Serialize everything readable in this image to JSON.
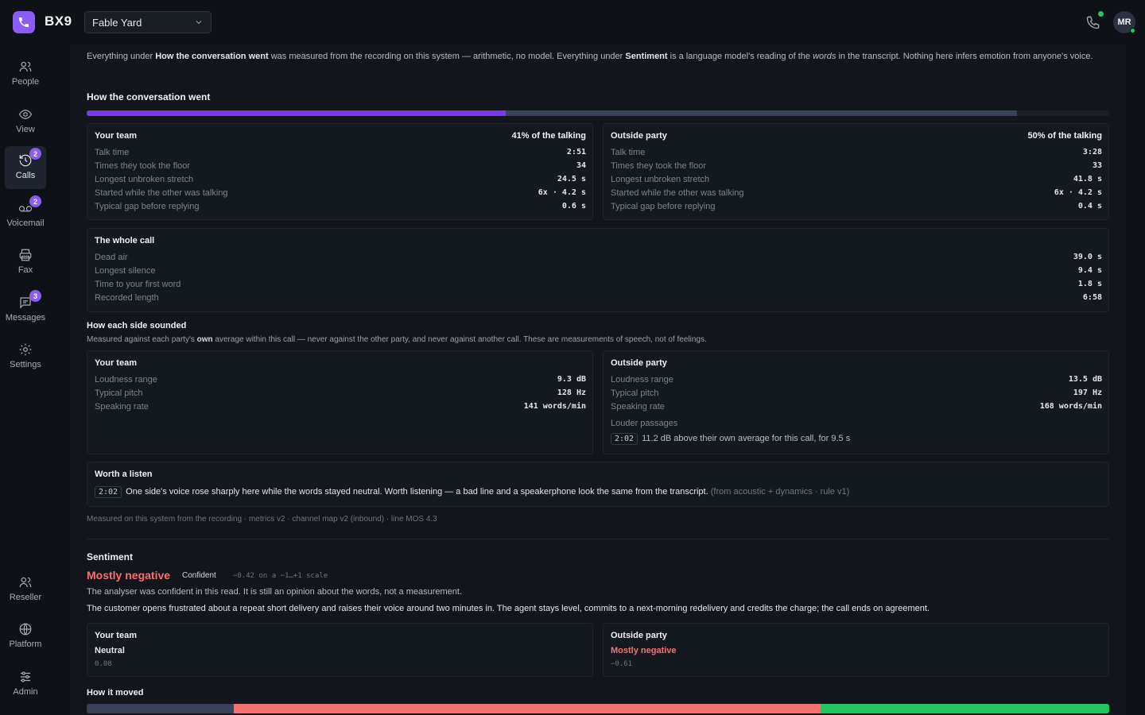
{
  "app": {
    "brand": "BX9",
    "org": "Fable Yard",
    "user_initials": "MR"
  },
  "colors": {
    "accent": "#8b5cf6",
    "negative": "#f87171",
    "positive": "#22c55e",
    "neutral_bar": "#394256"
  },
  "sidebar": {
    "items": [
      {
        "label": "People",
        "icon": "people-icon",
        "badge": ""
      },
      {
        "label": "View",
        "icon": "eye-icon",
        "badge": ""
      },
      {
        "label": "Calls",
        "icon": "history-icon",
        "badge": "2"
      },
      {
        "label": "Voicemail",
        "icon": "voicemail-icon",
        "badge": "2"
      },
      {
        "label": "Fax",
        "icon": "printer-icon",
        "badge": ""
      },
      {
        "label": "Messages",
        "icon": "message-icon",
        "badge": "3"
      },
      {
        "label": "Settings",
        "icon": "gear-icon",
        "badge": ""
      }
    ],
    "bottom": [
      {
        "label": "Reseller",
        "icon": "reseller-icon"
      },
      {
        "label": "Platform",
        "icon": "globe-icon"
      },
      {
        "label": "Admin",
        "icon": "sliders-icon"
      }
    ]
  },
  "intro": {
    "p1": "Everything under ",
    "b1": "How the conversation went",
    "p2": " was measured from the recording on this system — arithmetic, no model. Everything under ",
    "b2": "Sentiment",
    "p3": " is a language model's reading of the ",
    "i1": "words",
    "p4": " in the transcript. Nothing here infers emotion from anyone's voice."
  },
  "conversation": {
    "title": "How the conversation went",
    "talk_share": {
      "your_team": 0.41,
      "outside_party": 0.5
    },
    "your_team": {
      "title": "Your team",
      "share_label": "41% of the talking",
      "rows": [
        {
          "label": "Talk time",
          "value": "2:51"
        },
        {
          "label": "Times they took the floor",
          "value": "34"
        },
        {
          "label": "Longest unbroken stretch",
          "value": "24.5 s"
        },
        {
          "label": "Started while the other was talking",
          "value": "6x · 4.2 s"
        },
        {
          "label": "Typical gap before replying",
          "value": "0.6 s"
        }
      ]
    },
    "outside_party": {
      "title": "Outside party",
      "share_label": "50% of the talking",
      "rows": [
        {
          "label": "Talk time",
          "value": "3:28"
        },
        {
          "label": "Times they took the floor",
          "value": "33"
        },
        {
          "label": "Longest unbroken stretch",
          "value": "41.8 s"
        },
        {
          "label": "Started while the other was talking",
          "value": "6x · 4.2 s"
        },
        {
          "label": "Typical gap before replying",
          "value": "0.4 s"
        }
      ]
    },
    "whole_call": {
      "title": "The whole call",
      "rows": [
        {
          "label": "Dead air",
          "value": "39.0 s"
        },
        {
          "label": "Longest silence",
          "value": "9.4 s"
        },
        {
          "label": "Time to your first word",
          "value": "1.8 s"
        },
        {
          "label": "Recorded length",
          "value": "6:58"
        }
      ]
    }
  },
  "sounded": {
    "title": "How each side sounded",
    "sub_a": "Measured against each party's ",
    "sub_b": "own",
    "sub_c": " average within this call — never against the other party, and never against another call. These are measurements of speech, not of feelings.",
    "your_team": {
      "title": "Your team",
      "rows": [
        {
          "label": "Loudness range",
          "value": "9.3 dB"
        },
        {
          "label": "Typical pitch",
          "value": "128 Hz"
        },
        {
          "label": "Speaking rate",
          "value": "141 words/min"
        }
      ]
    },
    "outside_party": {
      "title": "Outside party",
      "rows": [
        {
          "label": "Loudness range",
          "value": "13.5 dB"
        },
        {
          "label": "Typical pitch",
          "value": "197 Hz"
        },
        {
          "label": "Speaking rate",
          "value": "168 words/min"
        }
      ],
      "louder_title": "Louder passages",
      "louder_ts": "2:02",
      "louder_text": "11.2 dB above their own average for this call, for 9.5 s"
    }
  },
  "worth": {
    "title": "Worth a listen",
    "ts": "2:02",
    "text": "One side's voice rose sharply here while the words stayed neutral. Worth listening — a bad line and a speakerphone look the same from the transcript.",
    "source": "(from acoustic + dynamics · rule v1)"
  },
  "footnote": "Measured on this system from the recording · metrics v2 · channel map v2 (inbound) · line MOS 4.3",
  "sentiment": {
    "title": "Sentiment",
    "verdict": "Mostly negative",
    "confidence": "Confident",
    "score_note": "−0.42 on a −1…+1 scale",
    "caveat": "The analyser was confident in this read. It is still an opinion about the words, not a measurement.",
    "summary": "The customer opens frustrated about a repeat short delivery and raises their voice around two minutes in. The agent stays level, commits to a next-morning redelivery and credits the charge; the call ends on agreement.",
    "your_team": {
      "title": "Your team",
      "label": "Neutral",
      "score": "0.08"
    },
    "outside_party": {
      "title": "Outside party",
      "label": "Mostly negative",
      "score": "−0.61"
    },
    "moved_title": "How it moved",
    "moved": [
      {
        "state": "neutral",
        "fraction": 0.144,
        "color": "#394256"
      },
      {
        "state": "negative",
        "fraction": 0.574,
        "color": "#f87171"
      },
      {
        "state": "positive",
        "fraction": 0.282,
        "color": "#22c55e"
      }
    ]
  }
}
